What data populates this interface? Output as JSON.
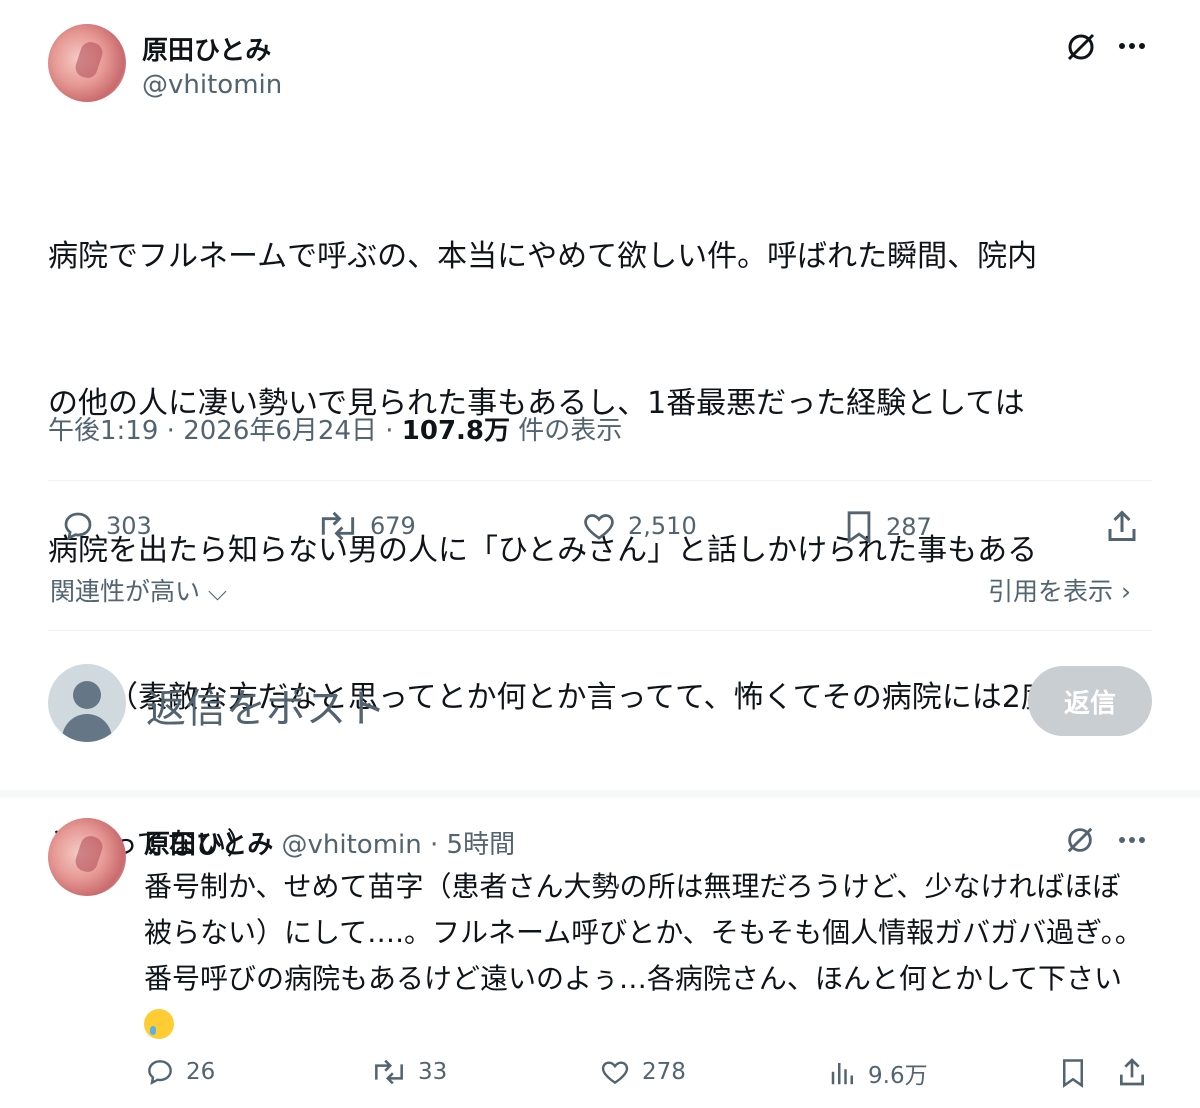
{
  "tweet": {
    "author_name": "原田ひとみ",
    "author_handle": "@vhitomin",
    "text": "病院でフルネームで呼ぶの、本当にやめて欲しい件。呼ばれた瞬間、院内の他の人に凄い勢いで見られた事もあるし、1番最悪だった経験としては病院を出たら知らない男の人に「ひとみさん」と話しかけられた事もあるん…（素敵な方だなと思ってとか何とか言ってて、怖くてその病院には2度と行ってない）",
    "text_lines": [
      "病院でフルネームで呼ぶの、本当にやめて欲しい件。呼ばれた瞬間、院内",
      "の他の人に凄い勢いで見られた事もあるし、1番最悪だった経験としては",
      "病院を出たら知らない男の人に「ひとみさん」と話しかけられた事もある",
      "ん…（素敵な方だなと思ってとか何とか言ってて、怖くてその病院には2度",
      "と行ってない）"
    ],
    "time": "午後1:19",
    "date": "2026年6月24日",
    "views_value": "107.8万",
    "views_label": "件の表示",
    "replies": "303",
    "retweets": "679",
    "likes": "2,510",
    "bookmarks": "287",
    "sort_label": "関連性が高い",
    "quotes_label": "引用を表示"
  },
  "reply_composer": {
    "placeholder": "返信をポスト",
    "button_label": "返信"
  },
  "reply": {
    "author_name": "原田ひとみ",
    "author_handle": "@vhitomin",
    "time_ago": "5時間",
    "text": "番号制か、せめて苗字（患者さん大勢の所は無理だろうけど、少なければほぼ被らない）にして….。フルネーム呼びとか、そもそも個人情報ガバガバ過ぎ。。番号呼びの病院もあるけど遠いのよぅ…各病院さん、ほんと何とかして下さい",
    "replies": "26",
    "retweets": "33",
    "likes": "278",
    "views": "9.6万"
  },
  "colors": {
    "text": "#0f1419",
    "secondary": "#536471",
    "divider": "#eff3f4",
    "disabled_button": "#c9ced2"
  }
}
